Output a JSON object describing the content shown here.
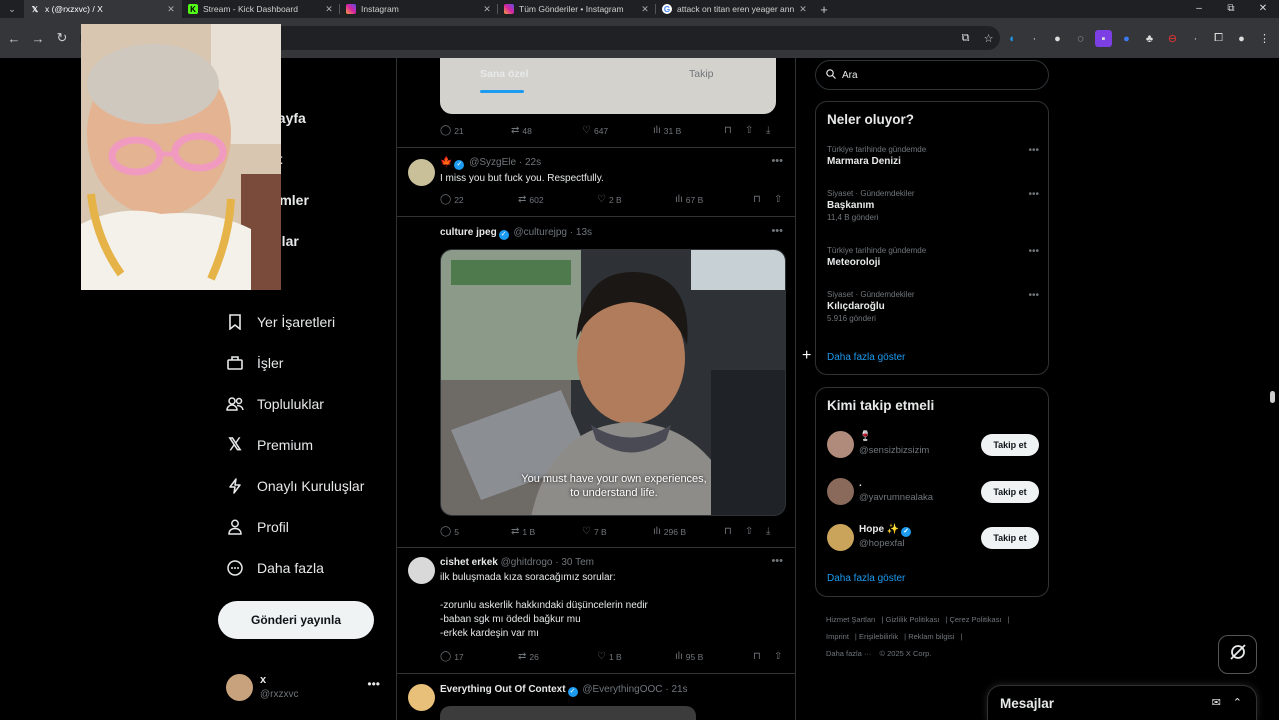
{
  "browser": {
    "tabs": [
      {
        "title": "x (@rxzxvc) / X",
        "icon": "x-logo-icon",
        "active": true
      },
      {
        "title": "Stream - Kick Dashboard",
        "icon": "kick-logo-icon",
        "active": false
      },
      {
        "title": "Instagram",
        "icon": "instagram-icon",
        "active": false
      },
      {
        "title": "Tüm Gönderiler • Instagram",
        "icon": "instagram-icon",
        "active": false
      },
      {
        "title": "attack on titan eren yeager ann",
        "icon": "google-icon",
        "active": false
      }
    ],
    "new_tab_label": "+",
    "window_controls": [
      "–",
      "⧉",
      "✕"
    ]
  },
  "timeline": {
    "tabs": [
      {
        "label": "Sana özel",
        "active": true
      },
      {
        "label": "Takip",
        "active": false
      }
    ],
    "tweets": [
      {
        "id": "t0",
        "stats": {
          "replies": "21",
          "reposts": "48",
          "likes": "647",
          "views": "31 B"
        }
      },
      {
        "id": "t1",
        "name": "",
        "handle": "@SyzgEle",
        "time": "22s",
        "text": "I miss you but fuck you. Respectfully.",
        "stats": {
          "replies": "22",
          "reposts": "602",
          "likes": "2 B",
          "views": "67 B"
        }
      },
      {
        "id": "t2",
        "name": "culture jpeg",
        "handle": "@culturejpg",
        "time": "13s",
        "caption": "You must have your own experiences,\nto understand life.",
        "stats": {
          "replies": "5",
          "reposts": "1 B",
          "likes": "7 B",
          "views": "296 B"
        }
      },
      {
        "id": "t3",
        "name": "cishet erkek",
        "handle": "@ghitdrogo",
        "time": "30 Tem",
        "text": "ilk buluşmada kıza soracağımız sorular:\n\n-zorunlu askerlik hakkındaki düşüncelerin nedir\n-baban sgk mı ödedi bağkur mu\n-erkek kardeşin var mı",
        "stats": {
          "replies": "17",
          "reposts": "26",
          "likes": "1 B",
          "views": "95 B"
        }
      },
      {
        "id": "t4",
        "name": "Everything Out Of Context",
        "handle": "@EverythingOOC",
        "time": "21s"
      }
    ]
  },
  "nav": {
    "items": [
      {
        "label": "sayfa",
        "icon": "home-icon"
      },
      {
        "label": "et",
        "icon": "search-icon"
      },
      {
        "label": "rimler",
        "icon": "bell-icon"
      },
      {
        "label": "ajlar",
        "icon": "mail-icon"
      },
      {
        "label": "k",
        "icon": "grok-icon"
      },
      {
        "label": "Yer İşaretleri",
        "icon": "bookmark-icon"
      },
      {
        "label": "İşler",
        "icon": "briefcase-icon"
      },
      {
        "label": "Topluluklar",
        "icon": "people-icon"
      },
      {
        "label": "Premium",
        "icon": "x-logo-icon"
      },
      {
        "label": "Onaylı Kuruluşlar",
        "icon": "lightning-icon"
      },
      {
        "label": "Profil",
        "icon": "person-icon"
      },
      {
        "label": "Daha fazla",
        "icon": "more-circle-icon"
      }
    ],
    "post_button": "Gönderi yayınla",
    "account": {
      "name": "x",
      "handle": "@rxzxvc"
    }
  },
  "right": {
    "search_placeholder": "Ara",
    "trends_title": "Neler oluyor?",
    "trends": [
      {
        "context": "Türkiye tarihinde gündemde",
        "name": "Marmara Denizi",
        "count": ""
      },
      {
        "context": "Siyaset · Gündemdekiler",
        "name": "Başkanım",
        "count": "11,4 B gönderi"
      },
      {
        "context": "Türkiye tarihinde gündemde",
        "name": "Meteoroloji",
        "count": ""
      },
      {
        "context": "Siyaset · Gündemdekiler",
        "name": "Kılıçdaroğlu",
        "count": "5.916 gönderi"
      }
    ],
    "trends_show_more": "Daha fazla göster",
    "who_title": "Kimi takip etmeli",
    "who": [
      {
        "name": "🍷",
        "handle": "@sensizbizsizim",
        "follow": "Takip et",
        "color": "#b08a7a"
      },
      {
        "name": ".",
        "handle": "@yavrumnealaka",
        "follow": "Takip et",
        "color": "#8a6a5a"
      },
      {
        "name": "Hope ✨",
        "handle": "@hopexfal",
        "follow": "Takip et",
        "color": "#c9a45a"
      }
    ],
    "who_show_more": "Daha fazla göster",
    "footer": [
      "Hizmet Şartları",
      "Gizlilik Politikası",
      "Çerez Politikası",
      "Imprint",
      "Erişilebilirlik",
      "Reklam bilgisi",
      "Daha fazla ···",
      "© 2025 X Corp."
    ]
  },
  "messages": {
    "title": "Mesajlar"
  },
  "colors": {
    "accent": "#1d9bf0",
    "background": "#000000",
    "border": "#2f3336",
    "muted": "#71767b"
  }
}
